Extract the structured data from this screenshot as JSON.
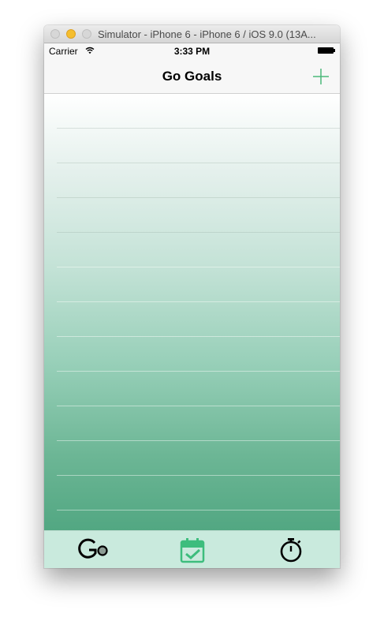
{
  "window": {
    "title": "Simulator - iPhone 6 - iPhone 6 / iOS 9.0 (13A..."
  },
  "status_bar": {
    "carrier": "Carrier",
    "time": "3:33 PM"
  },
  "nav_bar": {
    "title": "Go Goals",
    "add_icon": "plus-icon"
  },
  "goals_list": {
    "rows": [
      "",
      "",
      "",
      "",
      "",
      "",
      "",
      "",
      "",
      "",
      "",
      "",
      ""
    ]
  },
  "tab_bar": {
    "tabs": [
      {
        "icon": "go-goals-icon",
        "selected": false
      },
      {
        "icon": "calendar-check-icon",
        "selected": true
      },
      {
        "icon": "stopwatch-icon",
        "selected": false
      }
    ],
    "accent_color": "#3dbd7d"
  },
  "colors": {
    "tint": "#4cb87a",
    "gradient_top": "#ffffff",
    "gradient_bottom": "#52a782",
    "tab_bar_background": "#c9eadd"
  }
}
